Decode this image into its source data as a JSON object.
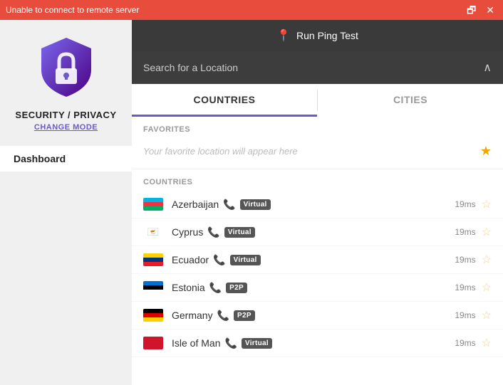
{
  "titlebar": {
    "text": "Unable to connect to remote server",
    "restore_btn": "🗗",
    "close_btn": "✕"
  },
  "sidebar": {
    "security_label": "SECURITY / PRIVACY",
    "change_mode": "CHANGE MODE",
    "nav_items": [
      {
        "label": "Dashboard"
      }
    ]
  },
  "ping_bar": {
    "icon": "📍",
    "label": "Run Ping Test"
  },
  "search": {
    "placeholder": "Search for a Location",
    "chevron": "∧"
  },
  "tabs": [
    {
      "label": "COUNTRIES",
      "active": true
    },
    {
      "label": "CITIES",
      "active": false
    }
  ],
  "favorites": {
    "header": "FAVORITES",
    "placeholder": "Your favorite location will appear here",
    "star": "★"
  },
  "countries_header": "COUNTRIES",
  "countries": [
    {
      "name": "Azerbaijan",
      "flag": "az",
      "badge": "Virtual",
      "badge_type": "virtual",
      "has_phone": true,
      "ping": "19ms"
    },
    {
      "name": "Cyprus",
      "flag": "cy",
      "badge": "Virtual",
      "badge_type": "virtual",
      "has_phone": true,
      "ping": "19ms"
    },
    {
      "name": "Ecuador",
      "flag": "ec",
      "badge": "Virtual",
      "badge_type": "virtual",
      "has_phone": true,
      "ping": "19ms"
    },
    {
      "name": "Estonia",
      "flag": "ee",
      "badge": "P2P",
      "badge_type": "p2p",
      "has_phone": true,
      "ping": "19ms"
    },
    {
      "name": "Germany",
      "flag": "de",
      "badge": "P2P",
      "badge_type": "p2p",
      "has_phone": true,
      "ping": "19ms"
    },
    {
      "name": "Isle of Man",
      "flag": "iom",
      "badge": "Virtual",
      "badge_type": "virtual",
      "has_phone": true,
      "ping": "19ms"
    }
  ],
  "colors": {
    "accent": "#6a5acd",
    "red": "#e74c3c",
    "star": "#f0a500"
  }
}
